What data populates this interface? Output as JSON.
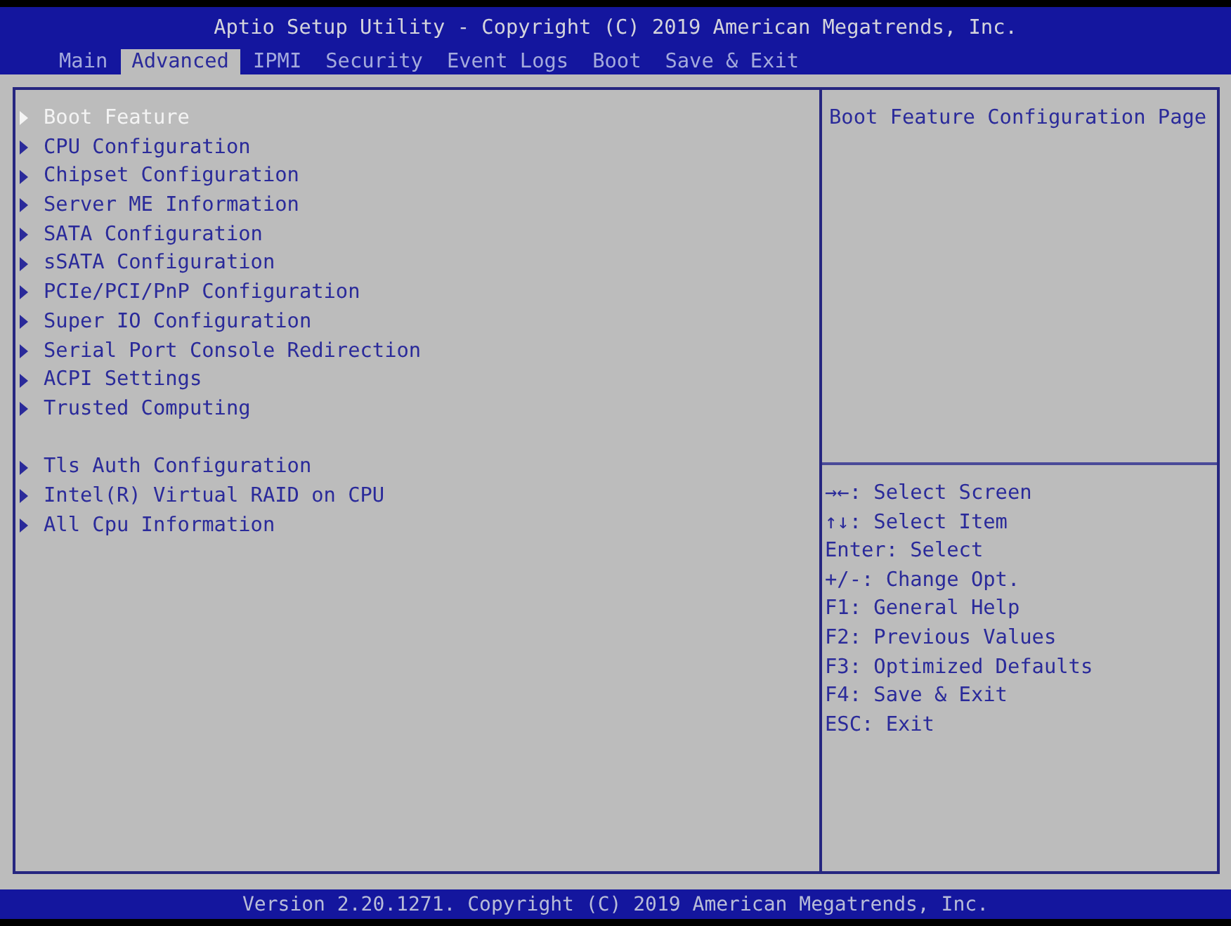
{
  "window": {
    "title": "Aptio Setup Utility - Copyright (C) 2019 American Megatrends, Inc."
  },
  "tabs": [
    {
      "label": "Main",
      "selected": false
    },
    {
      "label": "Advanced",
      "selected": true
    },
    {
      "label": "IPMI",
      "selected": false
    },
    {
      "label": "Security",
      "selected": false
    },
    {
      "label": "Event Logs",
      "selected": false
    },
    {
      "label": "Boot",
      "selected": false
    },
    {
      "label": "Save & Exit",
      "selected": false
    }
  ],
  "menu": {
    "groups": [
      {
        "items": [
          {
            "label": "Boot Feature",
            "selected": true
          },
          {
            "label": "CPU Configuration",
            "selected": false
          },
          {
            "label": "Chipset Configuration",
            "selected": false
          },
          {
            "label": "Server ME Information",
            "selected": false
          },
          {
            "label": "SATA Configuration",
            "selected": false
          },
          {
            "label": "sSATA Configuration",
            "selected": false
          },
          {
            "label": "PCIe/PCI/PnP Configuration",
            "selected": false
          },
          {
            "label": "Super IO Configuration",
            "selected": false
          },
          {
            "label": "Serial Port Console Redirection",
            "selected": false
          },
          {
            "label": "ACPI Settings",
            "selected": false
          },
          {
            "label": "Trusted Computing",
            "selected": false
          }
        ]
      },
      {
        "items": [
          {
            "label": "Tls Auth Configuration",
            "selected": false
          },
          {
            "label": "Intel(R) Virtual RAID on CPU",
            "selected": false
          },
          {
            "label": "All Cpu Information",
            "selected": false
          }
        ]
      }
    ]
  },
  "help": {
    "description": "Boot Feature Configuration Page",
    "keys": [
      "→←: Select Screen",
      "↑↓: Select Item",
      "Enter: Select",
      "+/-: Change Opt.",
      "F1: General Help",
      "F2: Previous Values",
      "F3: Optimized Defaults",
      "F4: Save & Exit",
      "ESC: Exit"
    ]
  },
  "status_bar": {
    "text": "Version 2.20.1271. Copyright (C) 2019 American Megatrends, Inc."
  }
}
